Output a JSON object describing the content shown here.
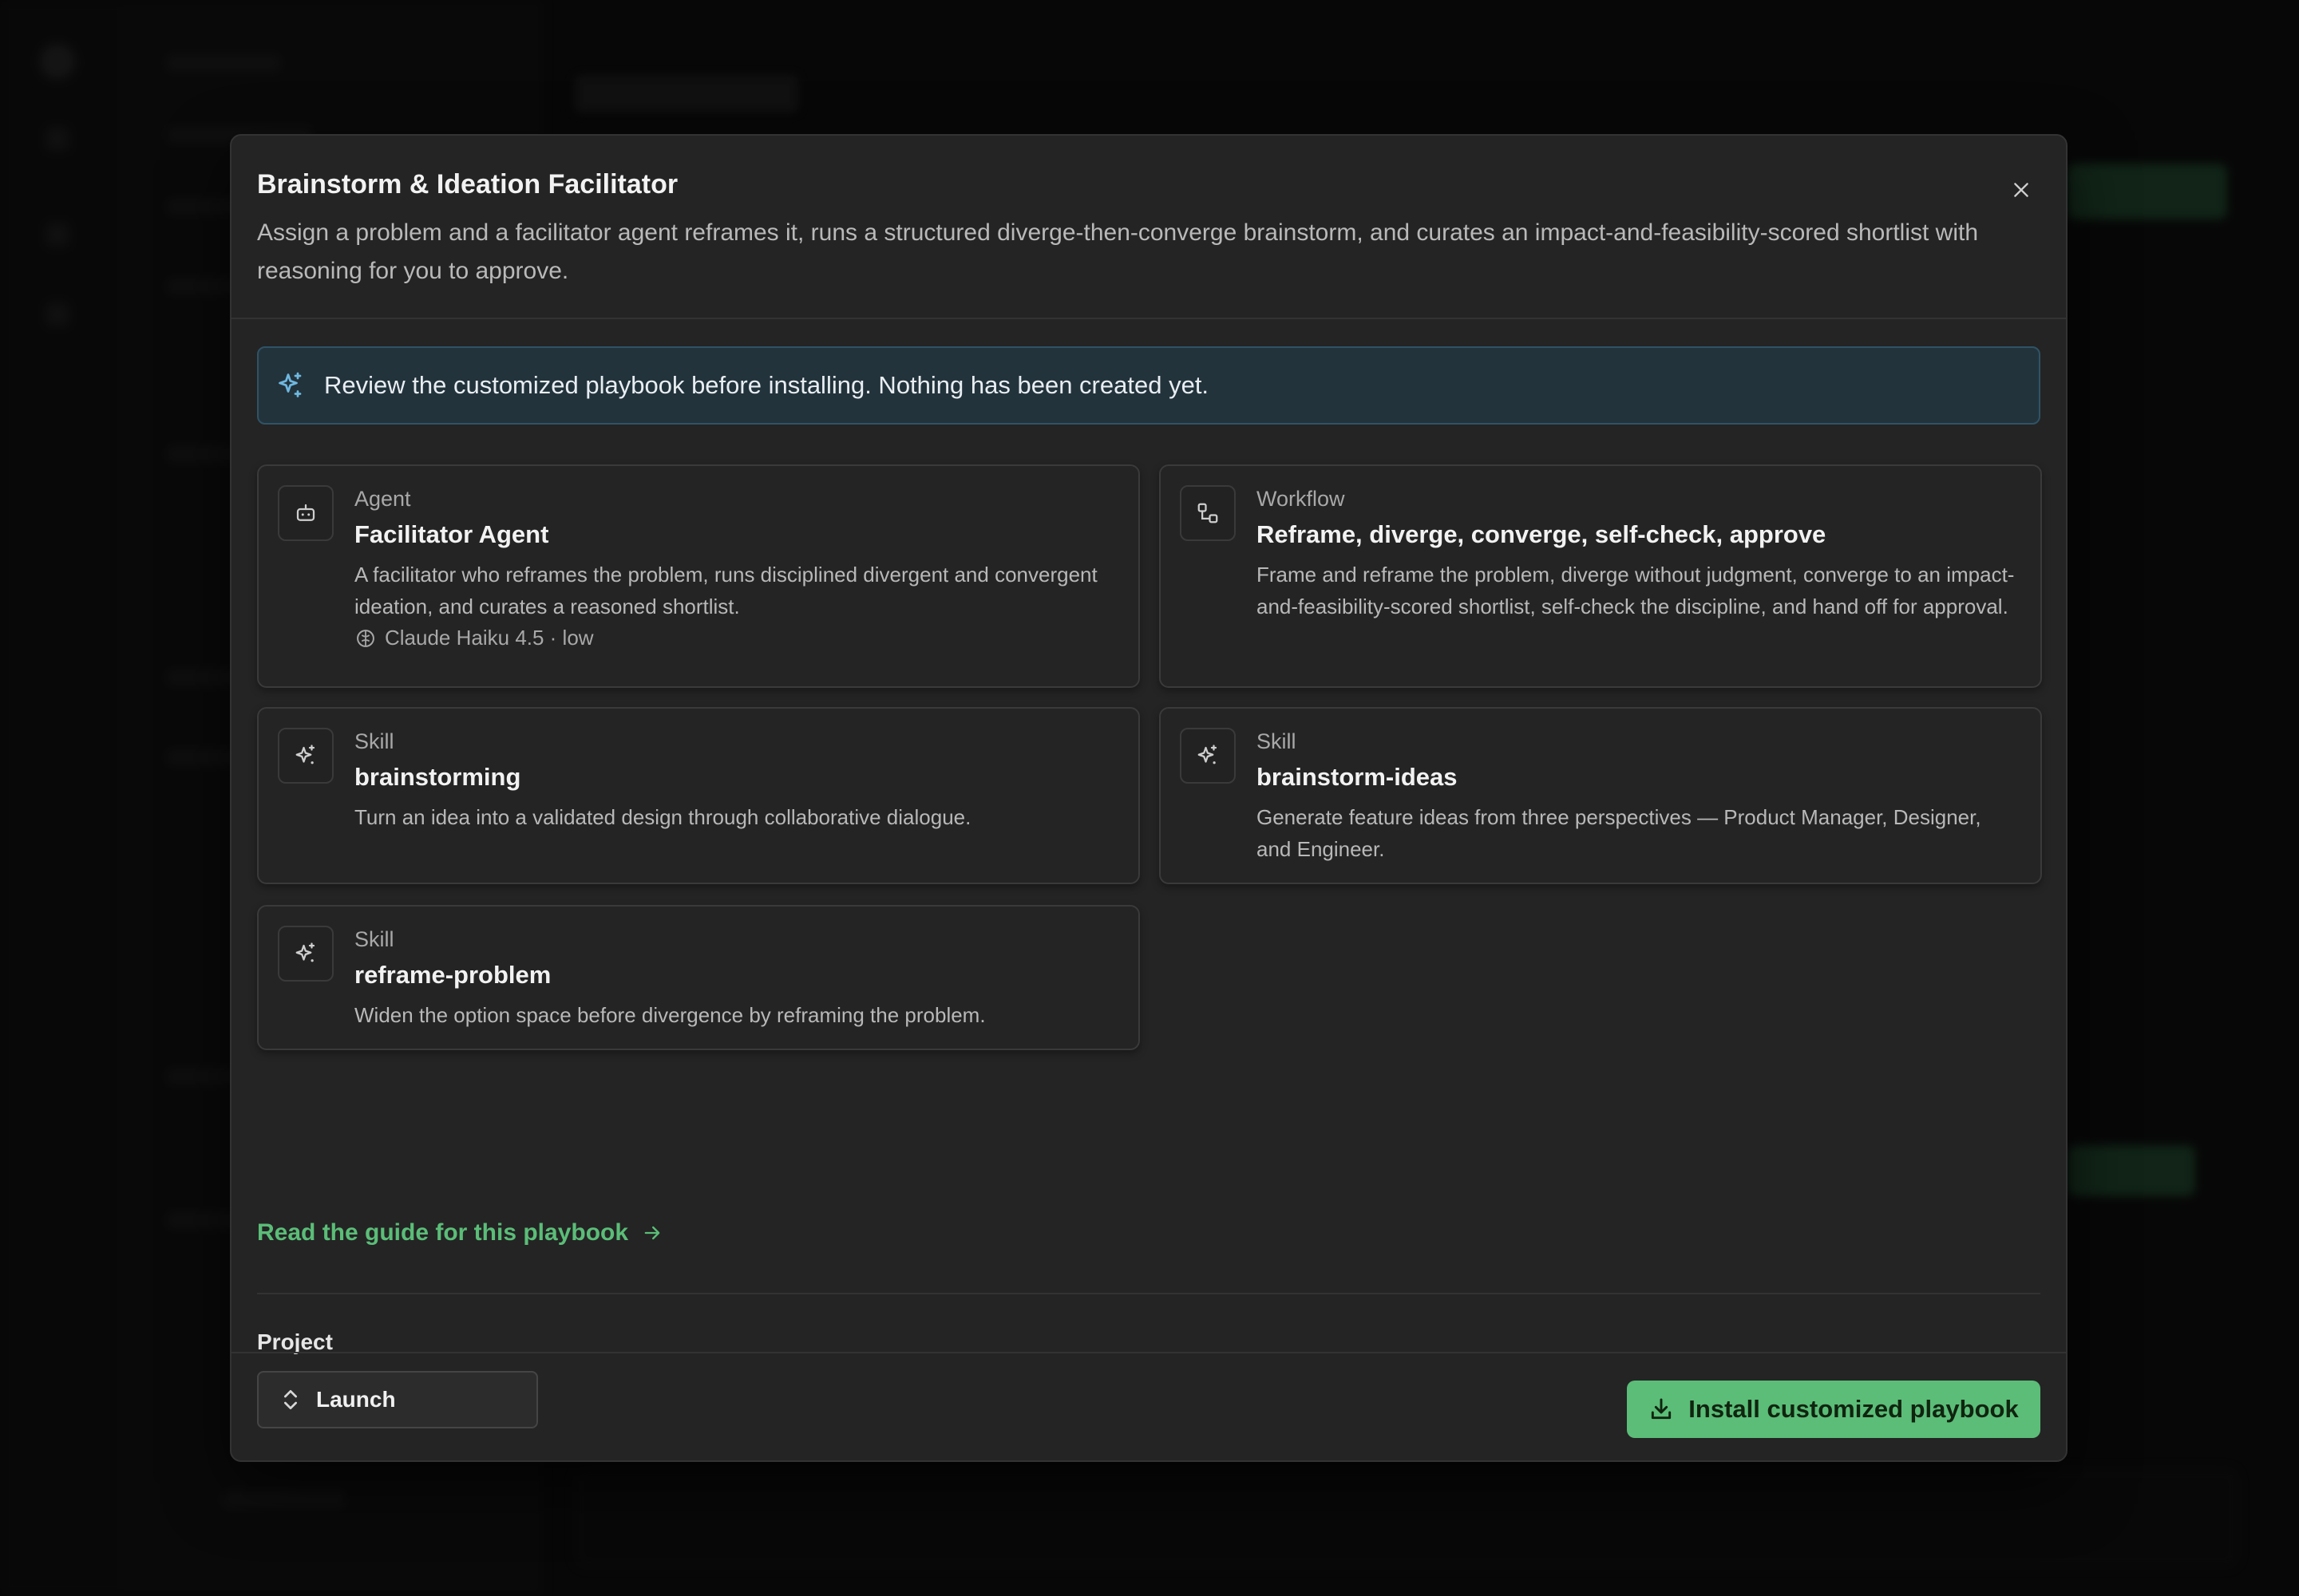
{
  "modal": {
    "title": "Brainstorm & Ideation Facilitator",
    "description": "Assign a problem and a facilitator agent reframes it, runs a structured diverge-then-converge brainstorm, and curates an impact-and-feasibility-scored shortlist with reasoning for you to approve.",
    "close_icon": "close-icon"
  },
  "banner": {
    "icon": "sparkles-icon",
    "text": "Review the customized playbook before installing. Nothing has been created yet."
  },
  "items": [
    {
      "type": "Agent",
      "name": "Facilitator Agent",
      "description": "A facilitator who reframes the problem, runs disciplined divergent and convergent ideation, and curates a reasoned shortlist.",
      "meta": "Claude Haiku 4.5 · low",
      "icon": "robot-icon",
      "meta_icon": "brain-icon"
    },
    {
      "type": "Workflow",
      "name": "Reframe, diverge, converge, self-check, approve",
      "description": "Frame and reframe the problem, diverge without judgment, converge to an impact-and-feasibility-scored shortlist, self-check the discipline, and hand off for approval.",
      "icon": "workflow-icon"
    },
    {
      "type": "Skill",
      "name": "brainstorming",
      "description": "Turn an idea into a validated design through collaborative dialogue.",
      "icon": "sparkles-icon"
    },
    {
      "type": "Skill",
      "name": "brainstorm-ideas",
      "description": "Generate feature ideas from three perspectives — Product Manager, Designer, and Engineer.",
      "icon": "sparkles-icon"
    },
    {
      "type": "Skill",
      "name": "reframe-problem",
      "description": "Widen the option space before divergence by reframing the problem.",
      "icon": "sparkles-icon"
    }
  ],
  "guide_link": {
    "label": "Read the guide for this playbook",
    "icon": "arrow-right-icon"
  },
  "project": {
    "label": "Project",
    "selected": "Launch",
    "icon": "chevron-up-down-icon"
  },
  "install_button": {
    "label": "Install customized playbook",
    "icon": "download-icon"
  },
  "colors": {
    "accent": "#5bbd78",
    "banner_bg": "#23333c",
    "banner_icon": "#6fb8e0"
  }
}
